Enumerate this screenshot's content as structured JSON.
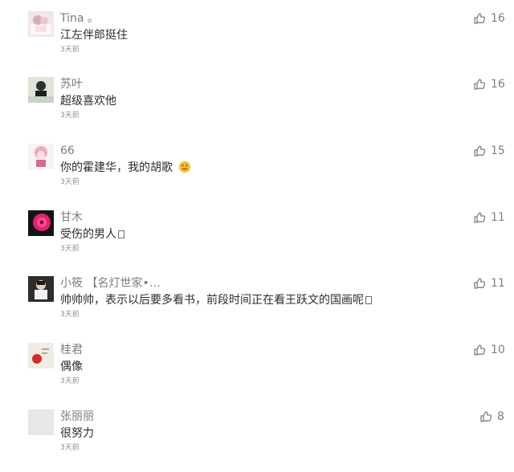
{
  "comments": [
    {
      "nickname": "Tina 。",
      "text": "江左伴郎挺住",
      "time": "3天前",
      "likes": "16",
      "avatar_icon": "avatar-photo"
    },
    {
      "nickname": "苏叶",
      "text": "超级喜欢他",
      "time": "3天前",
      "likes": "16",
      "avatar_icon": "avatar-photo"
    },
    {
      "nickname": "66",
      "text": "你的霍建华，我的胡歌",
      "time": "3天前",
      "likes": "15",
      "avatar_icon": "avatar-photo",
      "emoji_icon": "thinking-face-icon"
    },
    {
      "nickname": "甘木",
      "text": "受伤的男人",
      "time": "3天前",
      "likes": "11",
      "avatar_icon": "avatar-photo",
      "missing_glyph": true
    },
    {
      "nickname": "小筱 【名灯世家•…",
      "text": "帅帅帅，表示以后要多看书，前段时间正在看王跃文的国画呢",
      "time": "3天前",
      "likes": "11",
      "avatar_icon": "avatar-photo",
      "missing_glyph": true
    },
    {
      "nickname": "桂君",
      "text": "偶像",
      "time": "3天前",
      "likes": "10",
      "avatar_icon": "avatar-photo"
    },
    {
      "nickname": "张丽丽",
      "text": "很努力",
      "time": "3天前",
      "likes": "8",
      "avatar_icon": "avatar-placeholder"
    }
  ],
  "colors": {
    "nickname": "#7b7b7b",
    "text": "#2c2c2c",
    "time": "#8c8c8c",
    "like": "#7f7f7f"
  }
}
